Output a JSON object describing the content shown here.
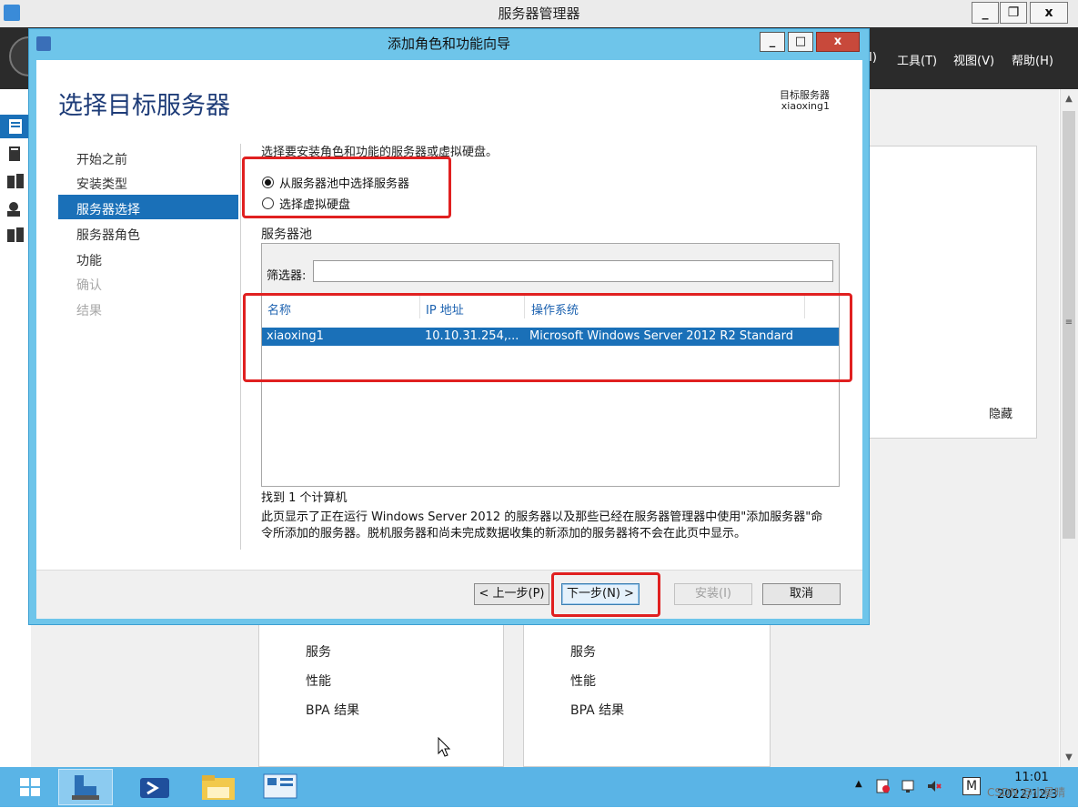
{
  "server_manager": {
    "title": "服务器管理器",
    "menu": [
      "I)",
      "工具(T)",
      "视图(V)",
      "帮助(H)"
    ],
    "hide_label": "隐藏",
    "tile_left_items": [
      "服务",
      "性能",
      "BPA 结果"
    ],
    "tile_right_items": [
      "服务",
      "性能",
      "BPA 结果"
    ]
  },
  "wizard": {
    "title": "添加角色和功能向导",
    "heading": "选择目标服务器",
    "destination_label": "目标服务器",
    "destination_value": "xiaoxing1",
    "steps": [
      {
        "label": "开始之前",
        "state": "normal"
      },
      {
        "label": "安装类型",
        "state": "normal"
      },
      {
        "label": "服务器选择",
        "state": "active"
      },
      {
        "label": "服务器角色",
        "state": "normal"
      },
      {
        "label": "功能",
        "state": "normal"
      },
      {
        "label": "确认",
        "state": "disabled"
      },
      {
        "label": "结果",
        "state": "disabled"
      }
    ],
    "instruction": "选择要安装角色和功能的服务器或虚拟硬盘。",
    "radio_options": [
      {
        "label": "从服务器池中选择服务器",
        "checked": true
      },
      {
        "label": "选择虚拟硬盘",
        "checked": false
      }
    ],
    "pool_label": "服务器池",
    "filter_label": "筛选器:",
    "filter_value": "",
    "columns": [
      "名称",
      "IP 地址",
      "操作系统"
    ],
    "rows": [
      {
        "name": "xiaoxing1",
        "ip": "10.10.31.254,...",
        "os": "Microsoft Windows Server 2012 R2 Standard",
        "selected": true
      }
    ],
    "found_count": "找到 1 个计算机",
    "description": "此页显示了正在运行 Windows Server 2012 的服务器以及那些已经在服务器管理器中使用\"添加服务器\"命令所添加的服务器。脱机服务器和尚未完成数据收集的新添加的服务器将不会在此页中显示。",
    "buttons": {
      "prev": "< 上一步(P)",
      "next": "下一步(N) >",
      "install": "安装(I)",
      "cancel": "取消"
    }
  },
  "taskbar": {
    "time": "11:01",
    "date": "2022/12/3",
    "ime": "M",
    "watermark": "CSDN @小星晴"
  },
  "colors": {
    "accent": "#1a70b8",
    "wizard_frame": "#6ec5ea",
    "highlight": "#e02020",
    "taskbar": "#5ab4e6"
  }
}
